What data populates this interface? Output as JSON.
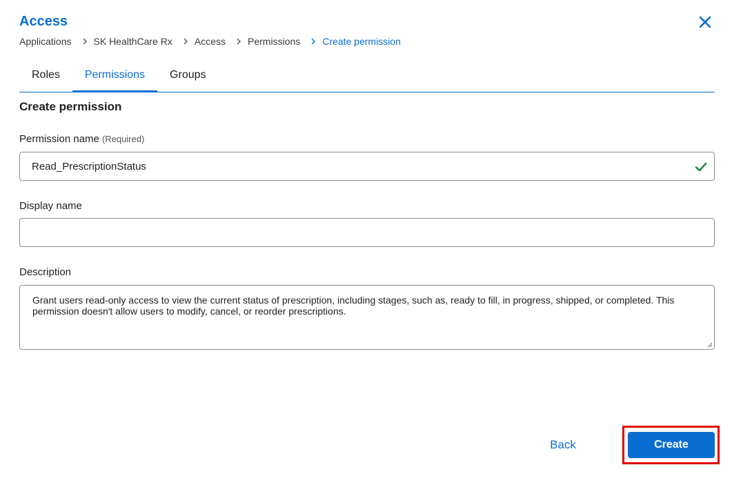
{
  "header": {
    "title": "Access",
    "close_icon": "close-icon"
  },
  "breadcrumb": [
    {
      "label": "Applications"
    },
    {
      "label": "SK HealthCare Rx"
    },
    {
      "label": "Access"
    },
    {
      "label": "Permissions"
    },
    {
      "label": "Create permission"
    }
  ],
  "tabs": [
    {
      "label": "Roles",
      "active": false
    },
    {
      "label": "Permissions",
      "active": true
    },
    {
      "label": "Groups",
      "active": false
    }
  ],
  "form": {
    "section_title": "Create permission",
    "permission_name": {
      "label": "Permission name",
      "required_text": "(Required)",
      "value": "Read_PrescriptionStatus",
      "valid": true
    },
    "display_name": {
      "label": "Display name",
      "value": ""
    },
    "description": {
      "label": "Description",
      "value": "Grant users read-only access to view the current status of prescription, including stages, such as, ready to fill, in progress, shipped, or completed. This permission doesn't allow users to modify, cancel, or reorder prescriptions."
    }
  },
  "actions": {
    "back_label": "Back",
    "create_label": "Create"
  },
  "colors": {
    "accent": "#0a6ed1",
    "success": "#1e8a3c",
    "highlight": "#e00000"
  }
}
